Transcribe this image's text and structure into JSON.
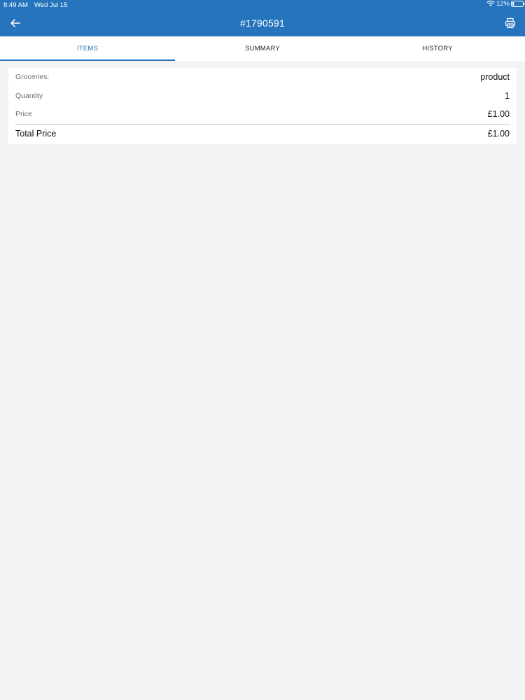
{
  "status_bar": {
    "time": "8:49 AM",
    "date": "Wed Jul 15",
    "battery": "12%",
    "icons": [
      "wifi-icon",
      "battery-icon"
    ]
  },
  "header": {
    "title": "#1790591",
    "back_icon": "arrow-left-icon",
    "print_icon": "printer-icon",
    "color": "#2574bd"
  },
  "tabs": [
    {
      "label": "ITEMS",
      "active": true
    },
    {
      "label": "SUMMARY",
      "active": false
    },
    {
      "label": "HISTORY",
      "active": false
    }
  ],
  "item_card": {
    "rows": [
      {
        "label": "Groceries:",
        "value": "product"
      },
      {
        "label": "Quantity",
        "value": "1"
      },
      {
        "label": "Price",
        "value": "£1.00"
      }
    ],
    "total": {
      "label": "Total Price",
      "value": "£1.00"
    }
  }
}
